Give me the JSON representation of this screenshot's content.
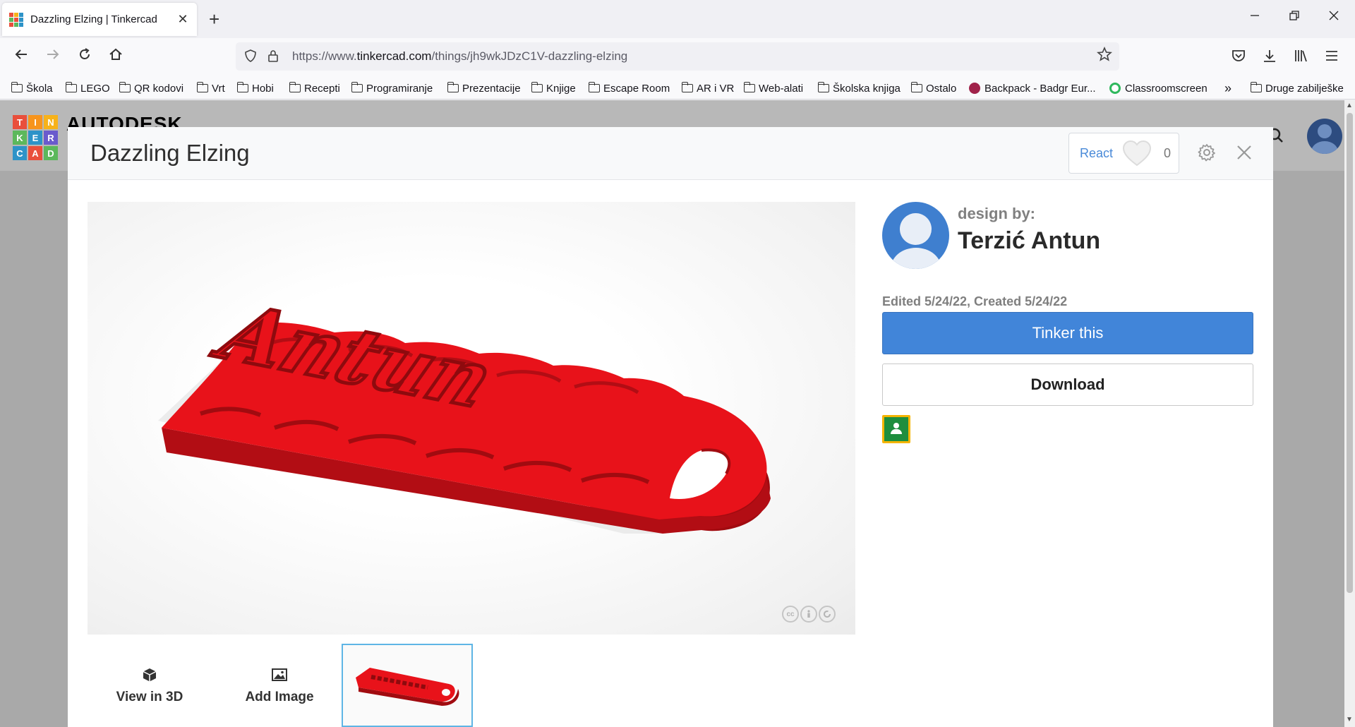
{
  "browser": {
    "tab_title": "Dazzling Elzing | Tinkercad",
    "tab_close": "✕",
    "new_tab": "+",
    "url_prefix": "https://www.",
    "url_domain": "tinkercad.com",
    "url_path": "/things/jh9wkJDzC1V-dazzling-elzing",
    "bookmarks": [
      "Škola",
      "LEGO",
      "QR kodovi",
      "Vrt",
      "Hobi",
      "Recepti",
      "Programiranje",
      "Prezentacije",
      "Knjige",
      "Escape Room",
      "AR i VR",
      "Web-alati",
      "Školska knjiga",
      "Ostalo",
      "Backpack - Badgr Eur...",
      "Classroomscreen",
      "Druge zabilješke"
    ],
    "bookmarks_overflow": "»"
  },
  "site": {
    "logo_letters": [
      "T",
      "I",
      "N",
      "K",
      "E",
      "R",
      "C",
      "A",
      "D"
    ],
    "logo_colors": [
      "#e94f3c",
      "#f7941d",
      "#f7b21a",
      "#5cb85c",
      "#2d93c8",
      "#6a5acd",
      "#2d93c8",
      "#e94f3c",
      "#5cb85c"
    ],
    "brand": "AUTODESK"
  },
  "modal": {
    "title": "Dazzling Elzing",
    "react_label": "React",
    "react_count": "0",
    "design_by_label": "design by:",
    "author_name": "Terzić Antun",
    "edited_text": "Edited 5/24/22, Created 5/24/22",
    "tinker_label": "Tinker this",
    "download_label": "Download",
    "view3d_label": "View in 3D",
    "add_image_label": "Add Image",
    "model_text": "Antun",
    "license_icons": [
      "cc",
      "by",
      "sa"
    ]
  },
  "colors": {
    "accent_blue": "#4185d9",
    "model_red": "#e8121a",
    "thumb_border": "#5eb5e5"
  }
}
